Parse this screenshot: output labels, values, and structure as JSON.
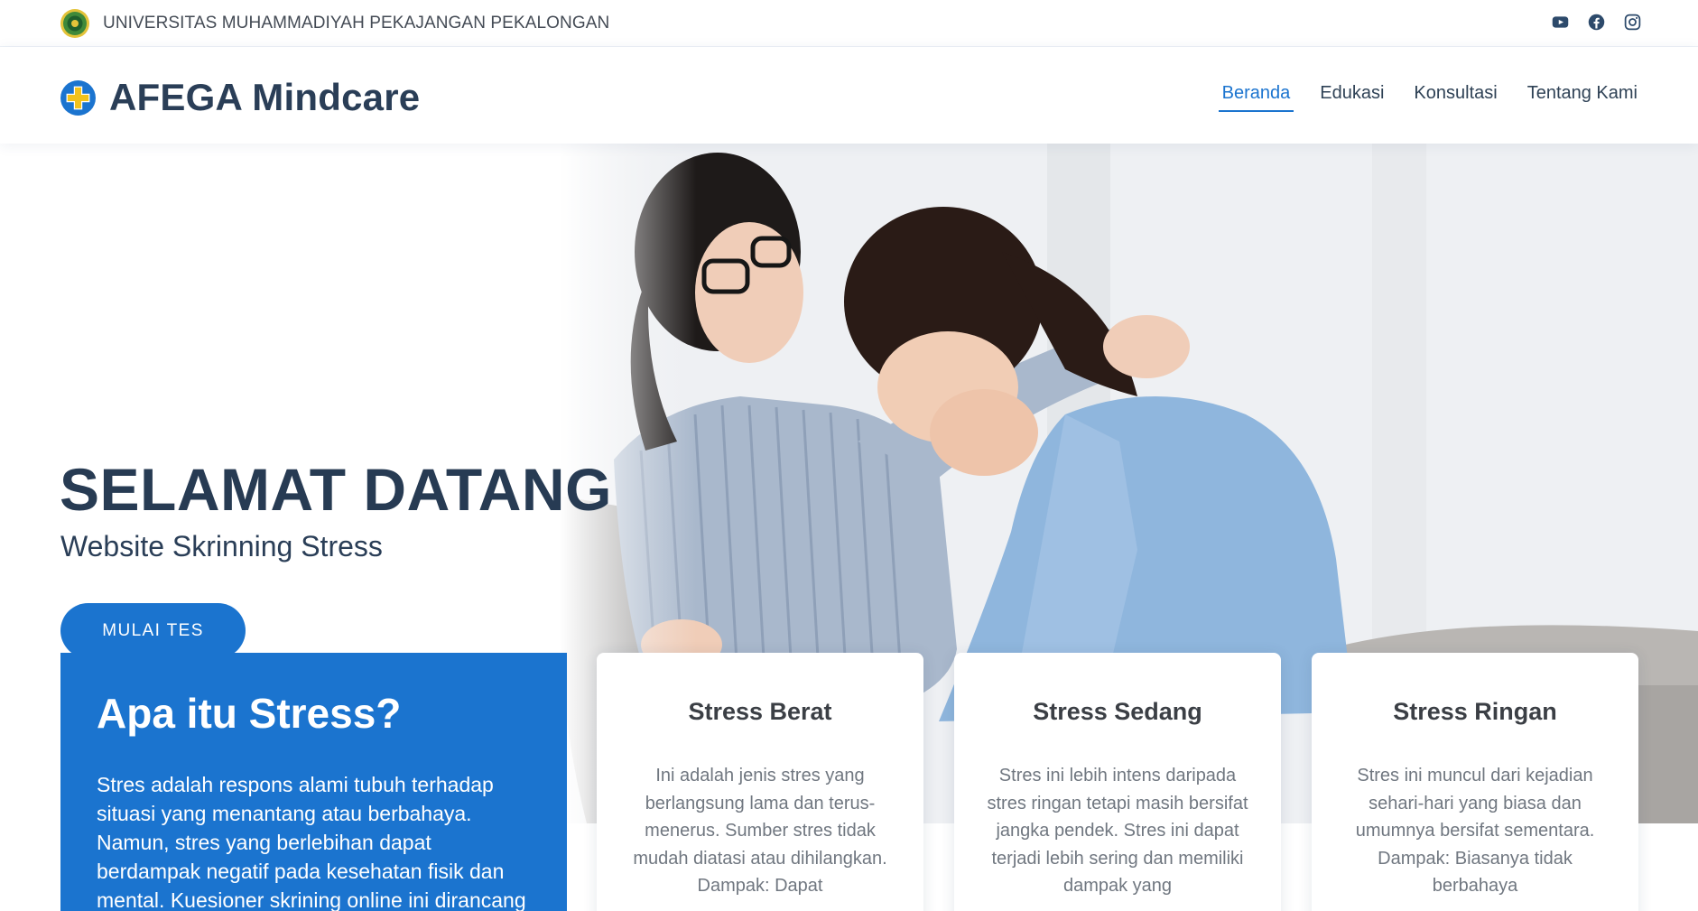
{
  "topbar": {
    "university_name": "UNIVERSITAS MUHAMMADIYAH PEKAJANGAN PEKALONGAN",
    "socials": [
      "youtube-icon",
      "facebook-icon",
      "instagram-icon"
    ]
  },
  "header": {
    "brand_name": "AFEGA Mindcare",
    "nav": [
      {
        "label": "Beranda",
        "active": true
      },
      {
        "label": "Edukasi",
        "active": false
      },
      {
        "label": "Konsultasi",
        "active": false
      },
      {
        "label": "Tentang Kami",
        "active": false
      }
    ]
  },
  "hero": {
    "title": "SELAMAT DATANG",
    "subtitle": "Website Skrinning Stress",
    "cta_label": "MULAI TES"
  },
  "about": {
    "title": "Apa itu Stress?",
    "text": "Stres adalah respons alami tubuh terhadap situasi yang menantang atau berbahaya. Namun, stres yang berlebihan dapat berdampak negatif pada kesehatan fisik dan mental. Kuesioner skrining online ini dirancang"
  },
  "cards": [
    {
      "title": "Stress Berat",
      "text": "Ini adalah jenis stres yang berlangsung lama dan terus-menerus. Sumber stres tidak mudah diatasi atau dihilangkan. Dampak: Dapat"
    },
    {
      "title": "Stress Sedang",
      "text": "Stres ini lebih intens daripada stres ringan tetapi masih bersifat jangka pendek. Stres ini dapat terjadi lebih sering dan memiliki dampak yang"
    },
    {
      "title": "Stress Ringan",
      "text": "Stres ini muncul dari kejadian sehari-hari yang biasa dan umumnya bersifat sementara. Dampak: Biasanya tidak berbahaya"
    }
  ],
  "colors": {
    "primary": "#1b74cf",
    "heading": "#273b53",
    "brand_icon_cross": "#f2c21b"
  }
}
